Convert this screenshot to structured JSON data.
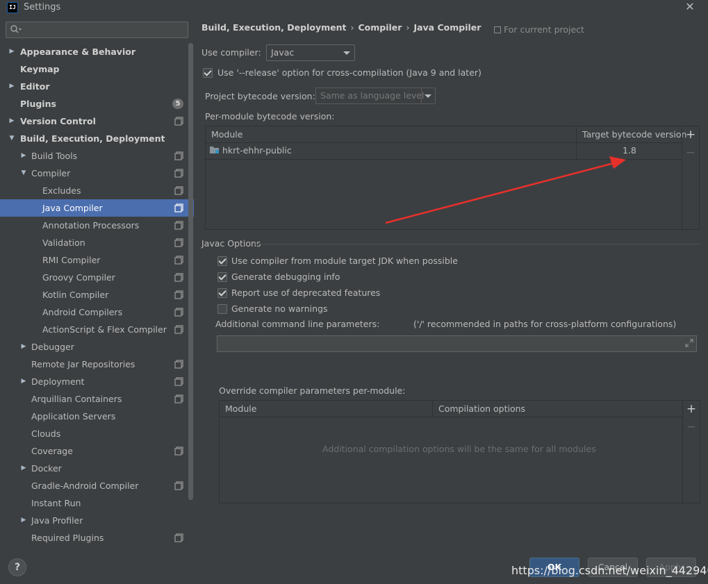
{
  "window": {
    "title": "Settings",
    "logo_text": "IJ"
  },
  "sidebar": {
    "search_placeholder": "",
    "items": [
      {
        "label": "Appearance & Behavior",
        "level": 0,
        "expander": "collapsed",
        "bold": true
      },
      {
        "label": "Keymap",
        "level": 0,
        "expander": "none",
        "bold": true
      },
      {
        "label": "Editor",
        "level": 0,
        "expander": "collapsed",
        "bold": true
      },
      {
        "label": "Plugins",
        "level": 0,
        "expander": "none",
        "bold": true,
        "badge": "5"
      },
      {
        "label": "Version Control",
        "level": 0,
        "expander": "collapsed",
        "bold": true,
        "project_icon": true
      },
      {
        "label": "Build, Execution, Deployment",
        "level": 0,
        "expander": "expanded",
        "bold": true
      },
      {
        "label": "Build Tools",
        "level": 1,
        "expander": "collapsed",
        "project_icon": true
      },
      {
        "label": "Compiler",
        "level": 1,
        "expander": "expanded",
        "project_icon": true
      },
      {
        "label": "Excludes",
        "level": 2,
        "expander": "none",
        "project_icon": true
      },
      {
        "label": "Java Compiler",
        "level": 2,
        "expander": "none",
        "project_icon": true,
        "selected": true
      },
      {
        "label": "Annotation Processors",
        "level": 2,
        "expander": "none",
        "project_icon": true
      },
      {
        "label": "Validation",
        "level": 2,
        "expander": "none",
        "project_icon": true
      },
      {
        "label": "RMI Compiler",
        "level": 2,
        "expander": "none",
        "project_icon": true
      },
      {
        "label": "Groovy Compiler",
        "level": 2,
        "expander": "none",
        "project_icon": true
      },
      {
        "label": "Kotlin Compiler",
        "level": 2,
        "expander": "none",
        "project_icon": true
      },
      {
        "label": "Android Compilers",
        "level": 2,
        "expander": "none",
        "project_icon": true
      },
      {
        "label": "ActionScript & Flex Compiler",
        "level": 2,
        "expander": "none",
        "project_icon": true
      },
      {
        "label": "Debugger",
        "level": 1,
        "expander": "collapsed"
      },
      {
        "label": "Remote Jar Repositories",
        "level": 1,
        "expander": "none",
        "project_icon": true
      },
      {
        "label": "Deployment",
        "level": 1,
        "expander": "collapsed",
        "project_icon": true
      },
      {
        "label": "Arquillian Containers",
        "level": 1,
        "expander": "none",
        "project_icon": true
      },
      {
        "label": "Application Servers",
        "level": 1,
        "expander": "none"
      },
      {
        "label": "Clouds",
        "level": 1,
        "expander": "none"
      },
      {
        "label": "Coverage",
        "level": 1,
        "expander": "none",
        "project_icon": true
      },
      {
        "label": "Docker",
        "level": 1,
        "expander": "collapsed"
      },
      {
        "label": "Gradle-Android Compiler",
        "level": 1,
        "expander": "none",
        "project_icon": true
      },
      {
        "label": "Instant Run",
        "level": 1,
        "expander": "none"
      },
      {
        "label": "Java Profiler",
        "level": 1,
        "expander": "collapsed"
      },
      {
        "label": "Required Plugins",
        "level": 1,
        "expander": "none",
        "project_icon": true
      }
    ]
  },
  "header": {
    "breadcrumb": [
      "Build, Execution, Deployment",
      "Compiler",
      "Java Compiler"
    ],
    "scope_label": "For current project"
  },
  "compiler": {
    "use_compiler_label": "Use compiler:",
    "use_compiler_value": "Javac",
    "release_option_label": "Use '--release' option for cross-compilation (Java 9 and later)",
    "release_option_checked": true,
    "project_bytecode_label": "Project bytecode version:",
    "project_bytecode_value": "Same as language level",
    "per_module_label": "Per-module bytecode version:",
    "module_table": {
      "columns": [
        "Module",
        "Target bytecode version"
      ],
      "rows": [
        {
          "module": "hkrt-ehhr-public",
          "version": "1.8"
        }
      ],
      "add_symbol": "+",
      "remove_symbol": "−"
    }
  },
  "javac": {
    "section_title": "Javac Options",
    "options": [
      {
        "label": "Use compiler from module target JDK when possible",
        "checked": true
      },
      {
        "label": "Generate debugging info",
        "checked": true
      },
      {
        "label": "Report use of deprecated features",
        "checked": true
      },
      {
        "label": "Generate no warnings",
        "checked": false
      }
    ],
    "additional_params_label": "Additional command line parameters:",
    "additional_params_hint": "('/' recommended in paths for cross-platform configurations)",
    "additional_params_value": "",
    "override_label": "Override compiler parameters per-module:",
    "override_table": {
      "columns": [
        "Module",
        "Compilation options"
      ],
      "empty_text": "Additional compilation options will be the same for all modules",
      "add_symbol": "+",
      "remove_symbol": "−"
    }
  },
  "footer": {
    "help_symbol": "?",
    "ok_label": "OK",
    "cancel_label": "Cancel",
    "apply_label": "Apply",
    "watermark": "https://blog.csdn.net/weixin_44294067"
  },
  "colors": {
    "background": "#3c3f41",
    "selection": "#4b6eaf",
    "primary_button": "#365880",
    "annotation_arrow": "#e8302a"
  }
}
